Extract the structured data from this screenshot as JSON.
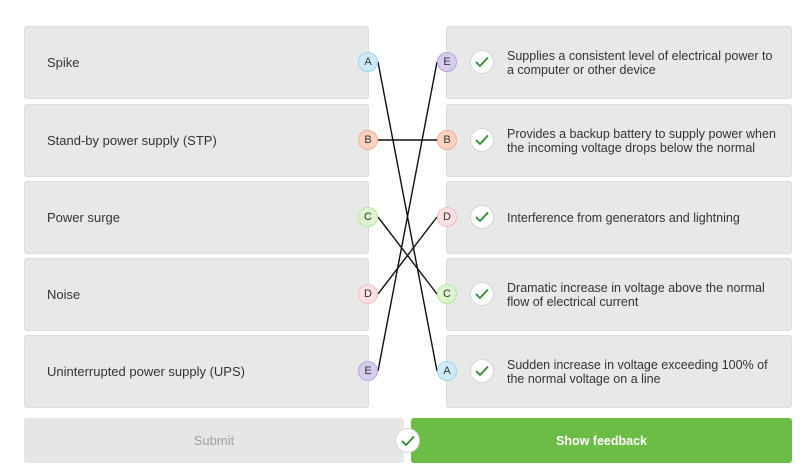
{
  "left_items": [
    {
      "label": "Spike",
      "letter": "A",
      "color": "#cdeaf7",
      "border": "#9fd3ec"
    },
    {
      "label": "Stand-by power supply (STP)",
      "letter": "B",
      "color": "#fbd3c0",
      "border": "#f1ae8f"
    },
    {
      "label": "Power surge",
      "letter": "C",
      "color": "#ddf5cf",
      "border": "#b8e6a0"
    },
    {
      "label": "Noise",
      "letter": "D",
      "color": "#fbe0e3",
      "border": "#f2bcc3"
    },
    {
      "label": "Uninterrupted power supply (UPS)",
      "letter": "E",
      "color": "#d8ccec",
      "border": "#b8a5dd"
    }
  ],
  "right_items": [
    {
      "text": "Supplies a consistent level of electrical power to a computer or other device",
      "letter": "E",
      "color": "#d8ccec",
      "border": "#b8a5dd",
      "correct": true
    },
    {
      "text": "Provides a backup battery to supply power when the incoming voltage drops below the normal",
      "letter": "B",
      "color": "#fbd3c0",
      "border": "#f1ae8f",
      "correct": true
    },
    {
      "text": "Interference from generators and lightning",
      "letter": "D",
      "color": "#fbe0e3",
      "border": "#f2bcc3",
      "correct": true
    },
    {
      "text": "Dramatic increase in voltage above the normal flow of electrical current",
      "letter": "C",
      "color": "#ddf5cf",
      "border": "#b8e6a0",
      "correct": true
    },
    {
      "text": "Sudden increase in voltage exceeding 100% of the normal voltage on a line",
      "letter": "A",
      "color": "#cdeaf7",
      "border": "#9fd3ec",
      "correct": true
    }
  ],
  "icons": {
    "check": "check-icon",
    "check_color": "#2e8b2e"
  },
  "buttons": {
    "submit_label": "Submit",
    "feedback_label": "Show feedback",
    "feedback_color": "#6cbd45",
    "submitted": true
  }
}
